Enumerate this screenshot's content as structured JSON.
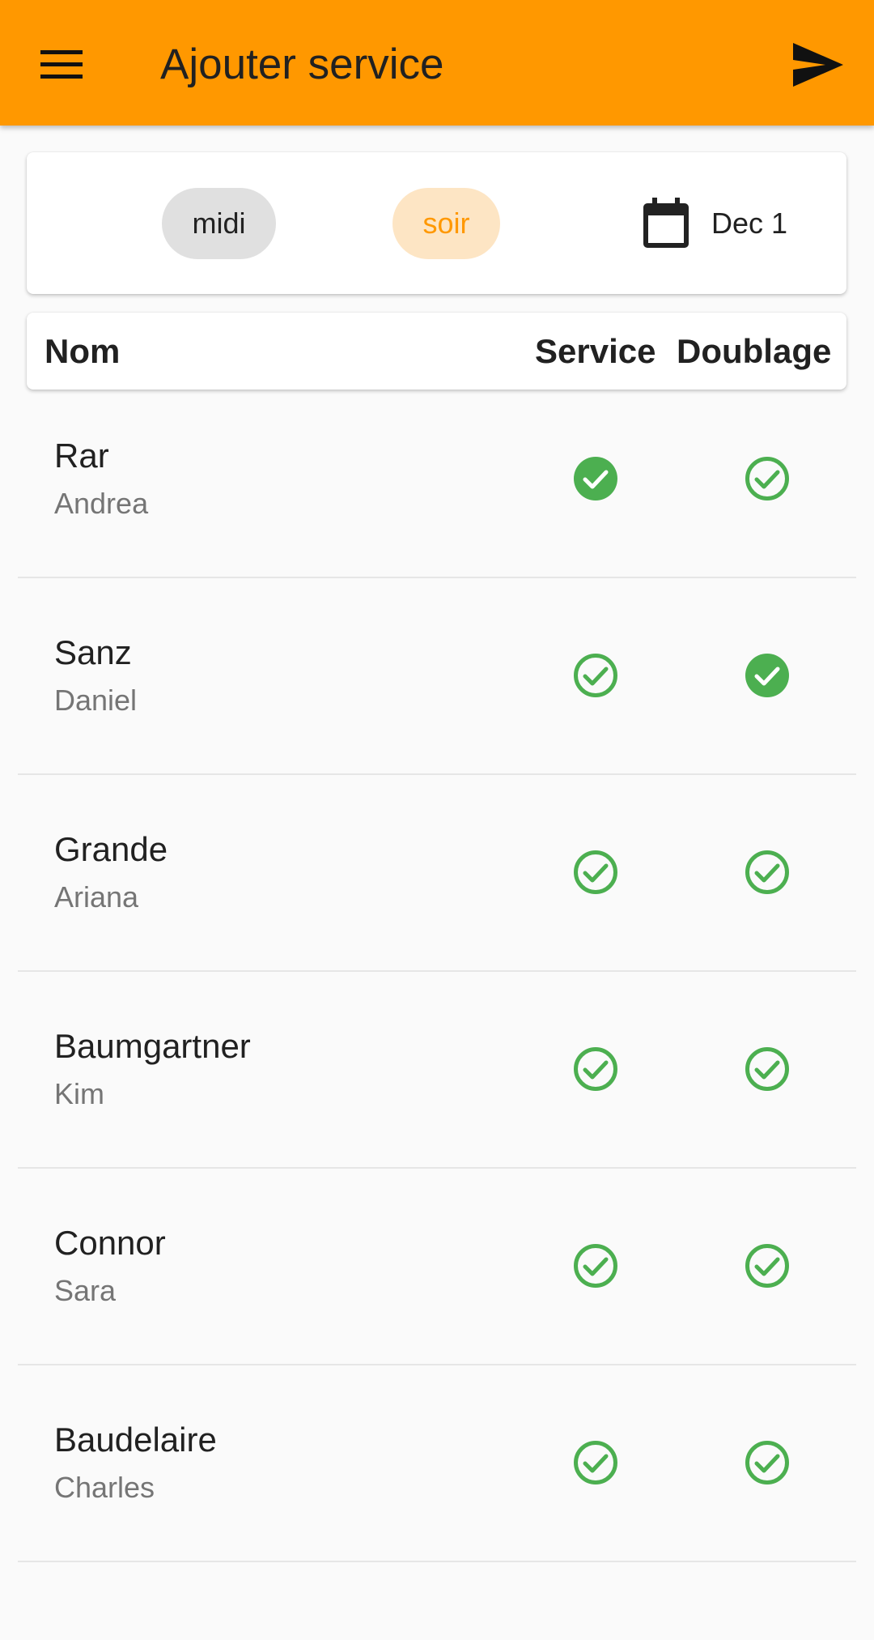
{
  "appbar": {
    "title": "Ajouter service",
    "menu_icon": "menu-icon",
    "send_icon": "send-icon",
    "color": "#ff9800"
  },
  "filters": {
    "midi_label": "midi",
    "soir_label": "soir",
    "selected": "soir",
    "date_label": "Dec 1",
    "calendar_icon": "calendar-icon"
  },
  "table": {
    "headers": {
      "nom": "Nom",
      "service": "Service",
      "doublage": "Doublage"
    },
    "rows": [
      {
        "last": "Rar",
        "first": "Andrea",
        "service": true,
        "doublage": false
      },
      {
        "last": "Sanz",
        "first": "Daniel",
        "service": false,
        "doublage": true
      },
      {
        "last": "Grande",
        "first": "Ariana",
        "service": false,
        "doublage": false
      },
      {
        "last": "Baumgartner",
        "first": "Kim",
        "service": false,
        "doublage": false
      },
      {
        "last": "Connor",
        "first": "Sara",
        "service": false,
        "doublage": false
      },
      {
        "last": "Baudelaire",
        "first": "Charles",
        "service": false,
        "doublage": false
      }
    ]
  },
  "colors": {
    "check": "#4caf50",
    "accent": "#ff9800"
  }
}
